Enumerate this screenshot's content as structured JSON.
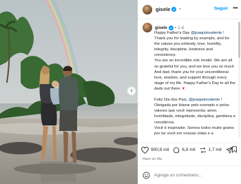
{
  "post": {
    "username": "gisele",
    "follow_label": "Seguir",
    "more_label": "•••",
    "time": "1 d",
    "separator": "•",
    "next_label": "›",
    "caption": {
      "lines_en_1": "Happy Father's Day ",
      "mention_en": "@joaquimvalente",
      "lines_en_2": " ! Thank you for leading by example, and for the values you embody, love, humility, integrity, discipline, kindness and consistency.\nYou are an incredible role model. We are all so grateful for you, and we love you so much\nAnd dad, thank you for your unconditional love, wisdom, and support through every stage of my life. Happy Father's Day to all the dads out there. ",
      "heart": "♥",
      "lines_pt_1": "\n\nFeliz Dia dos Pais, ",
      "mention_pt": "@joaquimvalente",
      "lines_pt_2": " ! Obrigada por liderar pelo exemplo e pelos valores que você representa: amor, humildade, integridade, disciplina, gentileza e constância.\nVocê é inspirador. Somos todos muito gratos por ter você em nossas vidas e a"
    },
    "likes": "900,8 mil",
    "comments": "6,9 mil",
    "shares": "1,7 mil",
    "date": "Hace un día",
    "comment_placeholder": "Agrega un comentario..."
  },
  "colors": {
    "link": "#0095f6",
    "mention": "#00376b",
    "heart": "#ed1e24",
    "verified": "#0095f6"
  },
  "icons": [
    "verified-icon",
    "heart-icon",
    "comment-icon",
    "share-icon",
    "send-icon",
    "bookmark-icon",
    "emoji-icon",
    "chevron-right-icon"
  ]
}
